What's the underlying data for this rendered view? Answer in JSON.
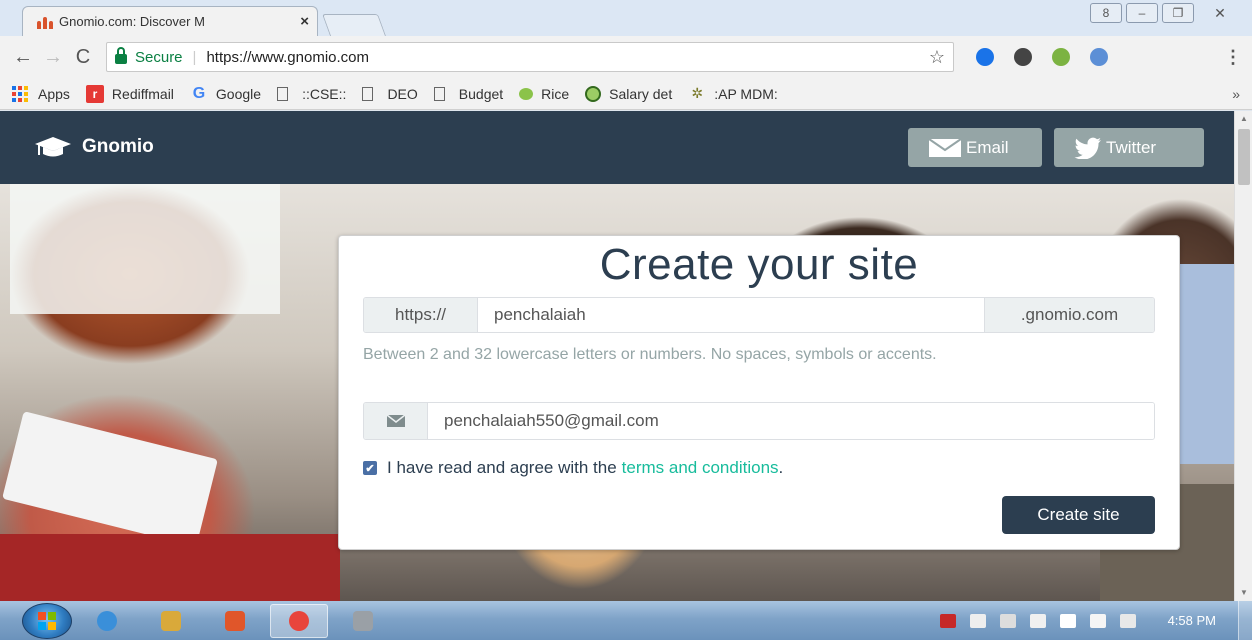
{
  "browser": {
    "tab": {
      "title": "Gnomio.com: Discover M",
      "close": "×"
    },
    "window_controls": {
      "user": "8",
      "minimize": "–",
      "maximize": "❐",
      "close": "✕"
    },
    "nav": {
      "back": "←",
      "forward": "→",
      "reload": "C"
    },
    "address": {
      "secure_label": "Secure",
      "separator": "|",
      "url": "https://www.gnomio.com",
      "star": "☆",
      "menu": "⋮"
    },
    "extension_colors": [
      "#1a73e8",
      "#444444",
      "#7cb342",
      "#5c8fd6"
    ],
    "bookmarks": [
      {
        "label": "Apps",
        "icon": "apps-grid-icon"
      },
      {
        "label": "Rediffmail",
        "icon": "rediff-icon"
      },
      {
        "label": "Google",
        "icon": "google-icon"
      },
      {
        "label": "::CSE::",
        "icon": "page-icon"
      },
      {
        "label": "DEO",
        "icon": "page-icon"
      },
      {
        "label": "Budget",
        "icon": "page-icon"
      },
      {
        "label": "Rice",
        "icon": "rice-icon"
      },
      {
        "label": "Salary det",
        "icon": "salary-icon"
      },
      {
        "label": ":AP MDM:",
        "icon": "mdm-icon"
      }
    ],
    "bookmarks_more": "»"
  },
  "site": {
    "brand": "Gnomio",
    "nav": {
      "email": "Email",
      "twitter": "Twitter"
    },
    "form": {
      "title": "Create your site",
      "url_prefix": "https://",
      "subdomain_value": "penchalaiah",
      "url_suffix": ".gnomio.com",
      "help_text": "Between 2 and 32 lowercase letters or numbers. No spaces, symbols or accents.",
      "email_value": "penchalaiah550@gmail.com",
      "agree_text": "I have read and agree with the",
      "terms_link": "terms and conditions",
      "agree_end": ".",
      "submit": "Create site"
    },
    "colors": {
      "navbar": "#2c3e50",
      "nav_button": "#95a5a6",
      "link": "#18bc9c",
      "primary": "#2c3e50"
    }
  },
  "taskbar": {
    "clock": "4:58 PM",
    "app_colors": [
      "#3a8fd9",
      "#d9a93a",
      "#e0562a",
      "#e8453c",
      "#9aa0a6"
    ]
  }
}
